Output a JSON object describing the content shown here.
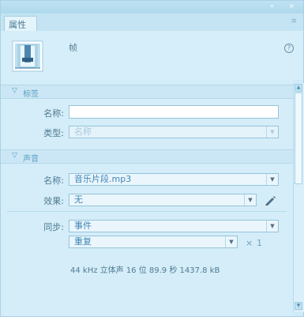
{
  "window": {
    "minimize_glyph": "«",
    "close_glyph": "×",
    "tab_label": "属性",
    "menu_glyph": "≡"
  },
  "header": {
    "symbol_icon": "button-symbol-icon",
    "symbol_type": "帧",
    "help_glyph": "?"
  },
  "sections": {
    "label": {
      "title": "标签",
      "name_label": "名称:",
      "name_value": "",
      "type_label": "类型:",
      "type_value": "名称"
    },
    "sound": {
      "title": "声音",
      "name_label": "名称:",
      "name_value": "音乐片段.mp3",
      "effect_label": "效果:",
      "effect_value": "无",
      "sync_label": "同步:",
      "sync_value": "事件",
      "repeat_value": "重复",
      "repeat_count_prefix": "×",
      "repeat_count": "1",
      "info": "44 kHz 立体声 16 位 89.9 秒 1437.8 kB"
    }
  },
  "icons": {
    "collapse": "triangle-down-icon",
    "dropdown": "chevron-down-icon",
    "edit": "pencil-icon"
  }
}
